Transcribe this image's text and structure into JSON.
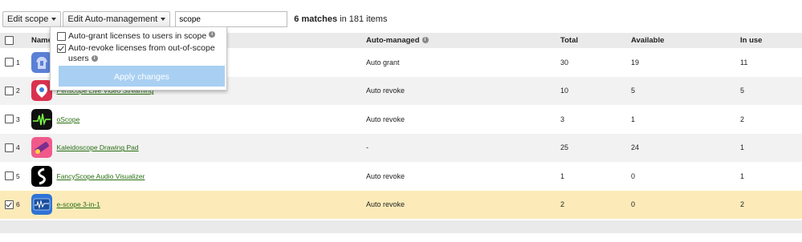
{
  "toolbar": {
    "edit_scope_label": "Edit scope",
    "edit_auto_label": "Edit Auto-management",
    "search_value": "scope",
    "matches_count": "6 matches",
    "matches_suffix": " in 181 items"
  },
  "dropdown": {
    "option1_label": "Auto-grant licenses to users in scope",
    "option1_checked": false,
    "option2_label_line1": "Auto-revoke licenses from out-of-scope",
    "option2_label_line2": "users",
    "option2_checked": true,
    "apply_label": "Apply changes"
  },
  "table": {
    "headers": {
      "name": "Name",
      "auto_managed": "Auto-managed",
      "total": "Total",
      "available": "Available",
      "in_use": "In use"
    },
    "rows": [
      {
        "index": "1",
        "name": "",
        "auto": "Auto grant",
        "total": "30",
        "available": "19",
        "in_use": "11",
        "icon": "hoodie-scope-icon",
        "checked": false
      },
      {
        "index": "2",
        "name": "Periscope Live Video Streaming",
        "auto": "Auto revoke",
        "total": "10",
        "available": "5",
        "in_use": "5",
        "icon": "periscope-icon",
        "checked": false
      },
      {
        "index": "3",
        "name": "oScope",
        "auto": "Auto revoke",
        "total": "3",
        "available": "1",
        "in_use": "2",
        "icon": "oscope-icon",
        "checked": false
      },
      {
        "index": "4",
        "name": "Kaleidoscope Drawing Pad",
        "auto": "-",
        "total": "25",
        "available": "24",
        "in_use": "1",
        "icon": "kaleidoscope-icon",
        "checked": false
      },
      {
        "index": "5",
        "name": "FancyScope Audio Visualizer",
        "auto": "Auto revoke",
        "total": "1",
        "available": "0",
        "in_use": "1",
        "icon": "fancyscope-icon",
        "checked": false
      },
      {
        "index": "6",
        "name": "e-scope 3-in-1",
        "auto": "Auto revoke",
        "total": "2",
        "available": "0",
        "in_use": "2",
        "icon": "escope-icon",
        "checked": true
      }
    ]
  },
  "colors": {
    "link": "#2a6e12",
    "selected_row": "#fcebb9",
    "apply_button": "#a9d0f2"
  }
}
